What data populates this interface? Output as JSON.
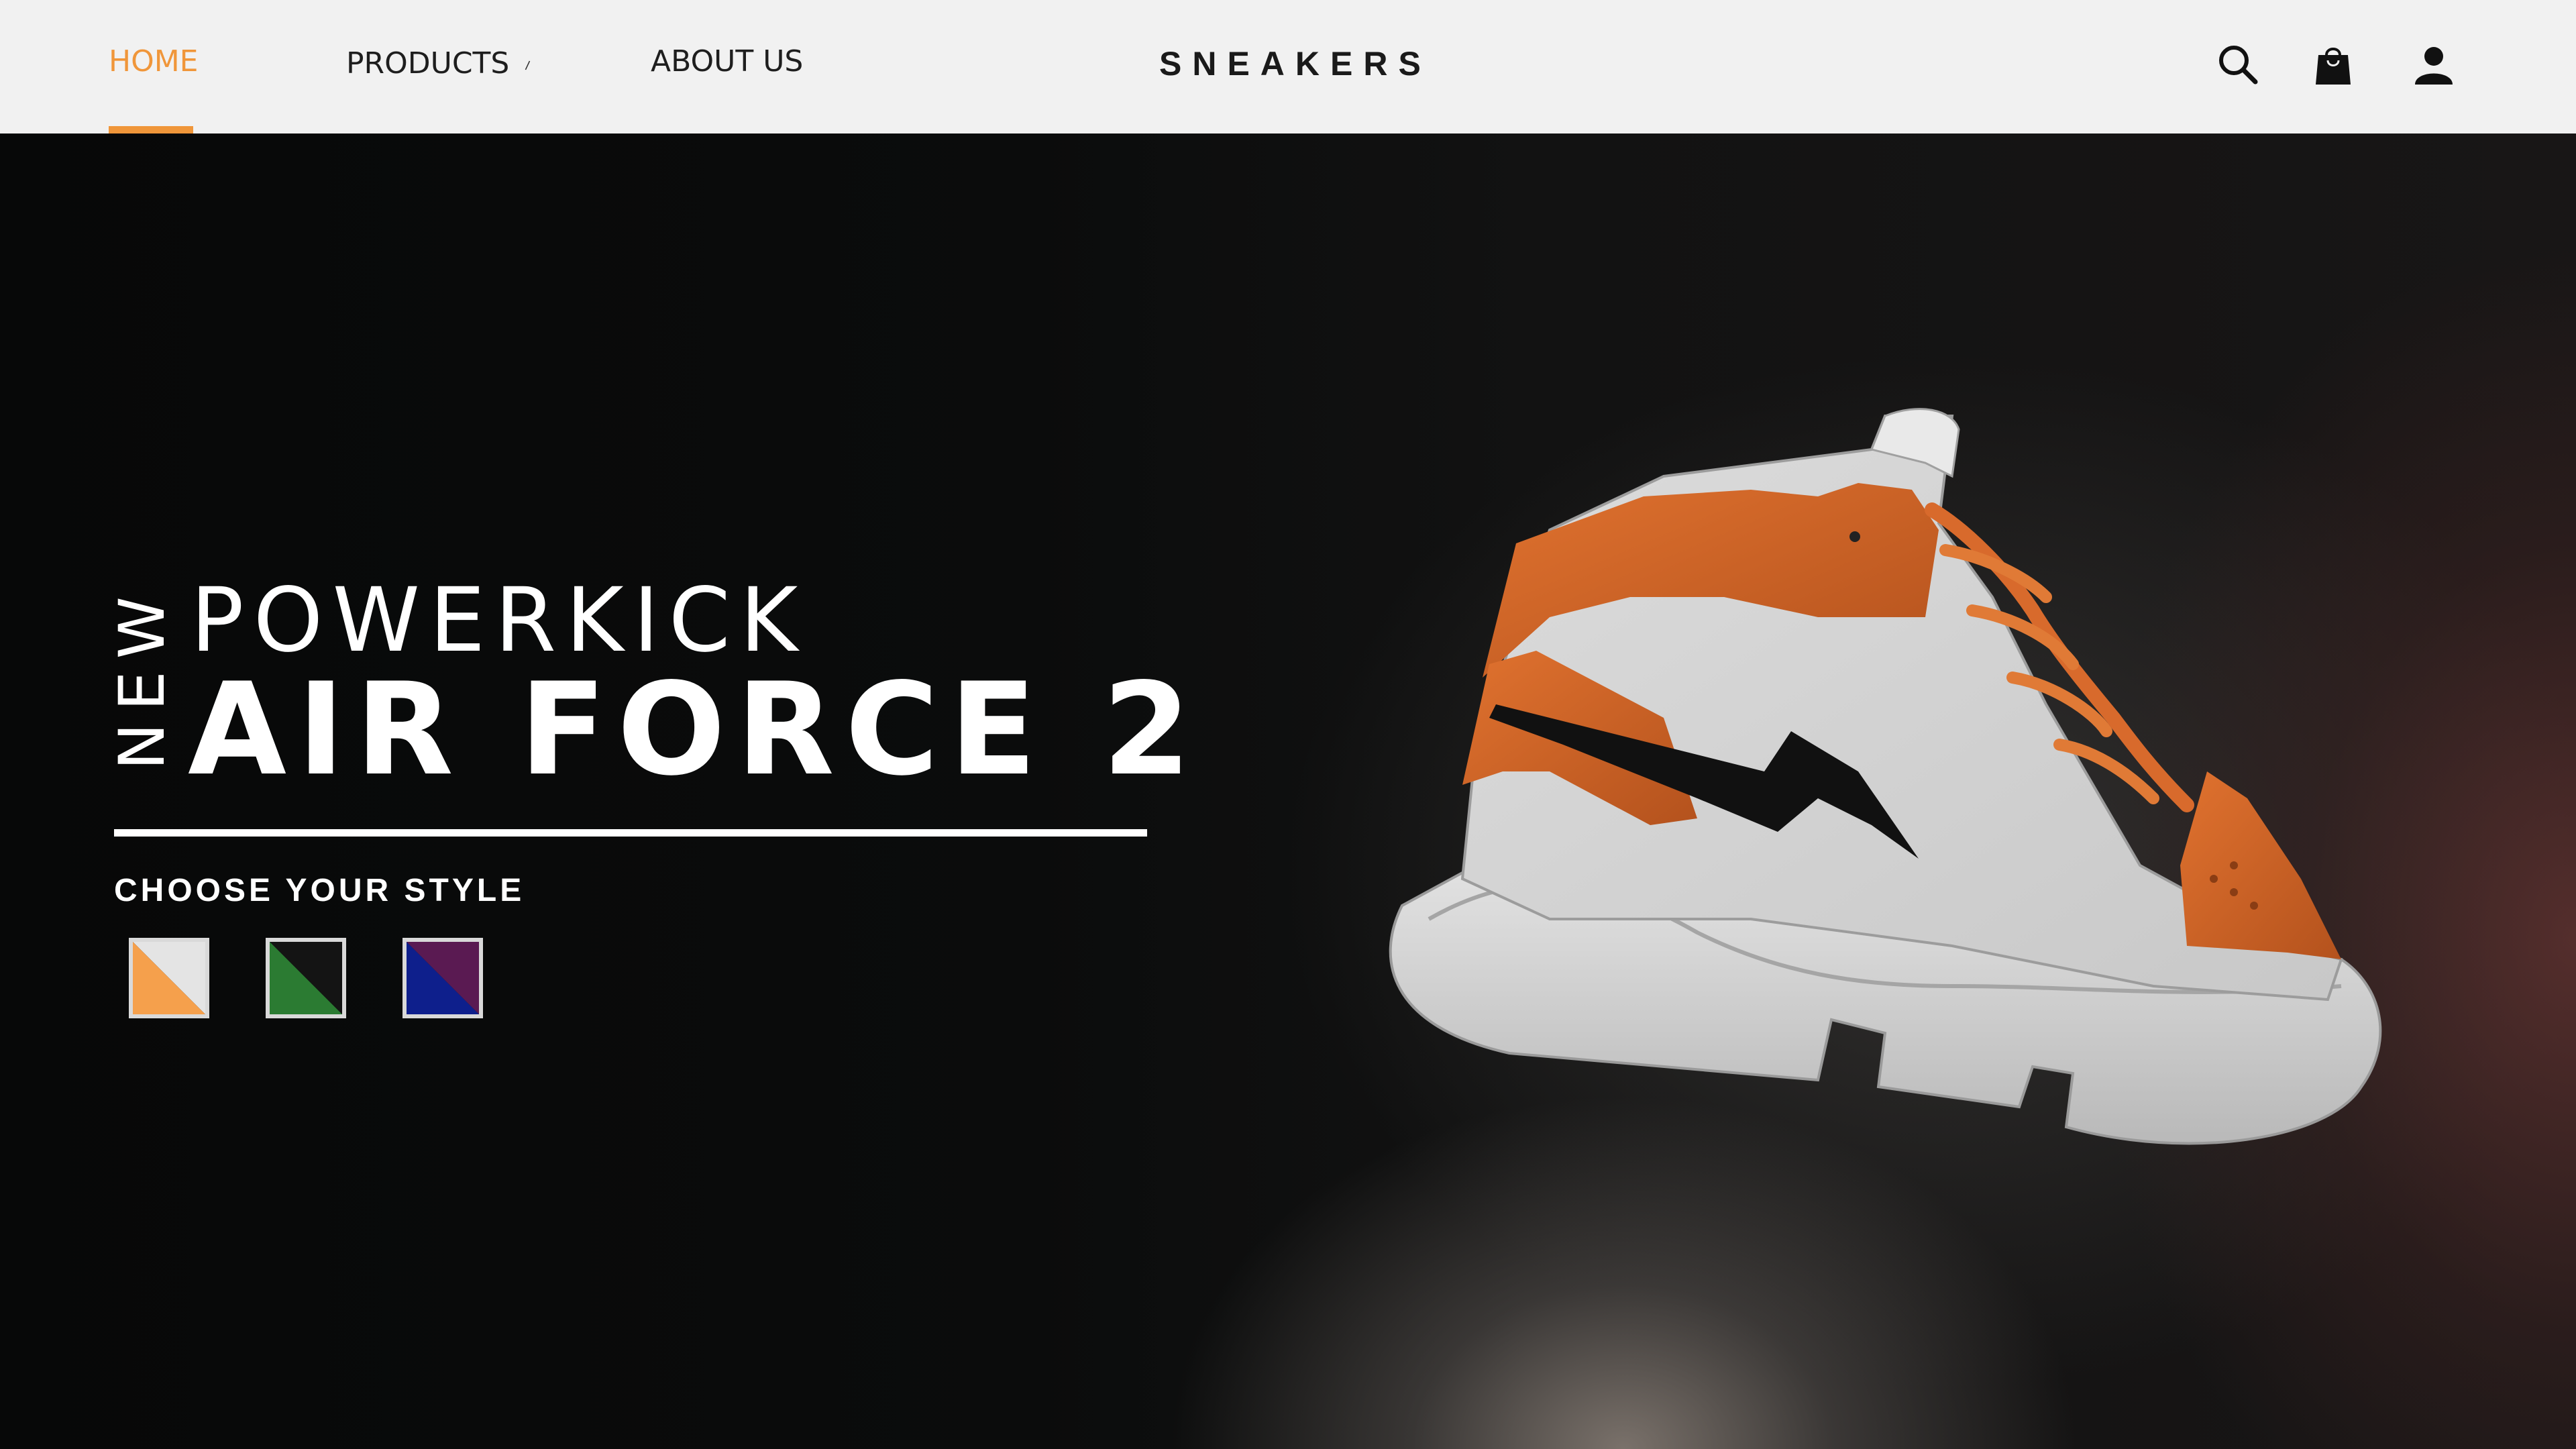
{
  "nav": {
    "home": "HOME",
    "products": "PRODUCTS",
    "products_chevron": "⌄",
    "about": "ABOUT US",
    "brand": "SNEAKERS",
    "active_color": "#f0963a"
  },
  "icons": {
    "search": "search-icon",
    "cart": "shopping-bag-icon",
    "account": "user-icon"
  },
  "hero": {
    "badge": "NEW",
    "title_line1": "POWERKICK",
    "title_line2": "AIR FORCE 2",
    "style_label": "CHOOSE YOUR STYLE",
    "swatches": [
      {
        "name": "orange-white",
        "color_a": "#f5a04c",
        "color_b": "#e4e4e4"
      },
      {
        "name": "green-black",
        "color_a": "#2b7b32",
        "color_b": "#141414"
      },
      {
        "name": "blue-purple",
        "color_a": "#0e1f8c",
        "color_b": "#5a1a52"
      }
    ],
    "product_image": "orange-white-high-top-sneaker"
  }
}
